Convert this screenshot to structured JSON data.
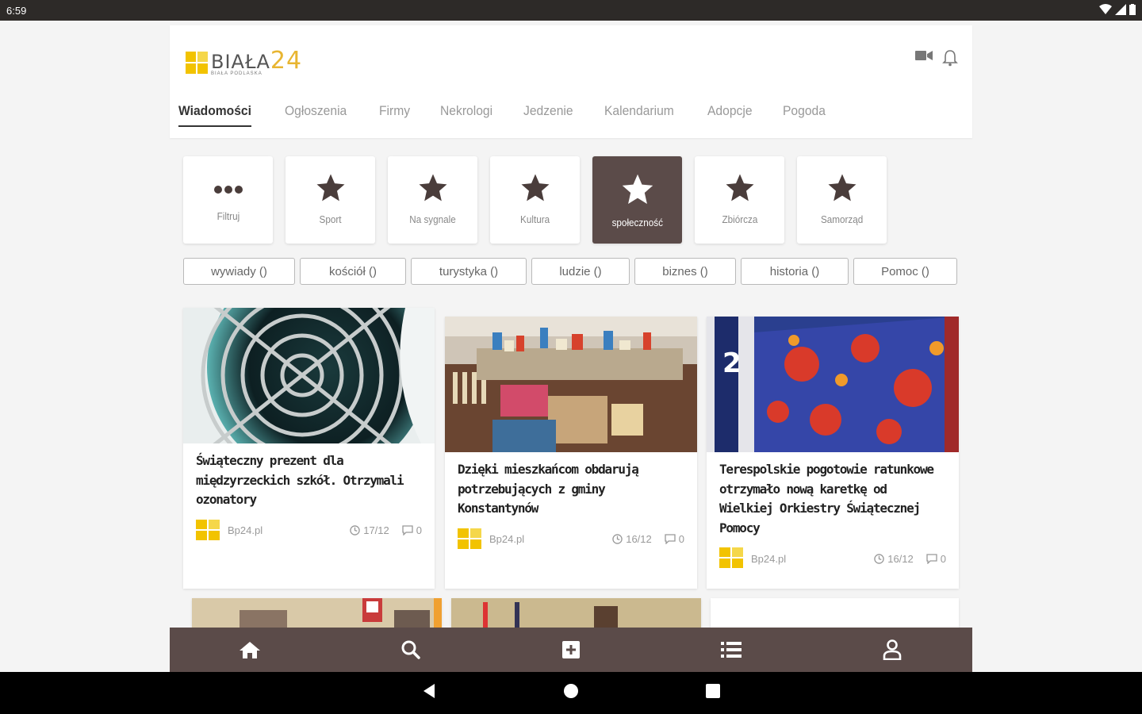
{
  "status_bar": {
    "time": "6:59"
  },
  "logo": {
    "name": "BIAŁA",
    "number": "24",
    "tagline": "BIAŁA PODLASKA"
  },
  "tabs": [
    {
      "label": "Wiadomości",
      "active": true
    },
    {
      "label": "Ogłoszenia"
    },
    {
      "label": "Firmy"
    },
    {
      "label": "Nekrologi"
    },
    {
      "label": "Jedzenie"
    },
    {
      "label": "Kalendarium"
    },
    {
      "label": "Adopcje"
    },
    {
      "label": "Pogoda"
    }
  ],
  "categories": [
    {
      "label": "Filtruj",
      "icon": "more-dots-icon"
    },
    {
      "label": "Sport",
      "icon": "star-icon"
    },
    {
      "label": "Na sygnale",
      "icon": "star-icon"
    },
    {
      "label": "Kultura",
      "icon": "star-icon"
    },
    {
      "label": "społeczność",
      "icon": "star-icon",
      "active": true
    },
    {
      "label": "Zbiórcza",
      "icon": "star-icon"
    },
    {
      "label": "Samorząd",
      "icon": "star-icon"
    }
  ],
  "tags": [
    "wywiady ()",
    "kościół ()",
    "turystyka ()",
    "ludzie ()",
    "biznes ()",
    "historia ()",
    "Pomoc ()"
  ],
  "articles": [
    {
      "title": "Świąteczny prezent dla międzyrzeckich szkół. Otrzymali ozonatory",
      "source": "Bp24.pl",
      "date": "17/12",
      "comments": "0"
    },
    {
      "title": "Dzięki mieszkańcom obdarują potrzebujących z gminy Konstantynów",
      "source": "Bp24.pl",
      "date": "16/12",
      "comments": "0"
    },
    {
      "title": "Terespolskie pogotowie ratunkowe otrzymało nową karetkę od Wielkiej Orkiestry Świątecznej Pomocy",
      "source": "Bp24.pl",
      "date": "16/12",
      "comments": "0"
    }
  ],
  "colors": {
    "brand": "#5b4b49",
    "accent": "#f2c300"
  }
}
